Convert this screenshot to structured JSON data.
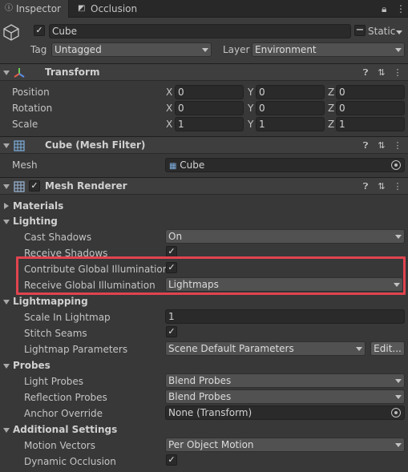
{
  "tabs": {
    "inspector": "Inspector",
    "occlusion": "Occlusion"
  },
  "object": {
    "name": "Cube",
    "active": true,
    "static_label": "Static",
    "tag_label": "Tag",
    "tag_value": "Untagged",
    "layer_label": "Layer",
    "layer_value": "Environment"
  },
  "transform": {
    "title": "Transform",
    "axes": {
      "x": "X",
      "y": "Y",
      "z": "Z"
    },
    "position": {
      "label": "Position",
      "x": "0",
      "y": "0",
      "z": "0"
    },
    "rotation": {
      "label": "Rotation",
      "x": "0",
      "y": "0",
      "z": "0"
    },
    "scale": {
      "label": "Scale",
      "x": "1",
      "y": "1",
      "z": "1"
    }
  },
  "mesh_filter": {
    "title": "Cube (Mesh Filter)",
    "mesh_label": "Mesh",
    "mesh_value": "Cube"
  },
  "mesh_renderer": {
    "title": "Mesh Renderer",
    "enabled": true,
    "materials": "Materials",
    "lighting": "Lighting",
    "cast_shadows_label": "Cast Shadows",
    "cast_shadows_value": "On",
    "receive_shadows_label": "Receive Shadows",
    "contribute_gi_label": "Contribute Global Illumination",
    "receive_gi_label": "Receive Global Illumination",
    "receive_gi_value": "Lightmaps",
    "lightmapping": "Lightmapping",
    "scale_lightmap_label": "Scale In Lightmap",
    "scale_lightmap_value": "1",
    "stitch_seams_label": "Stitch Seams",
    "lightmap_params_label": "Lightmap Parameters",
    "lightmap_params_value": "Scene Default Parameters",
    "edit_button": "Edit...",
    "probes": "Probes",
    "light_probes_label": "Light Probes",
    "light_probes_value": "Blend Probes",
    "reflection_probes_label": "Reflection Probes",
    "reflection_probes_value": "Blend Probes",
    "anchor_override_label": "Anchor Override",
    "anchor_override_value": "None (Transform)",
    "additional": "Additional Settings",
    "motion_vectors_label": "Motion Vectors",
    "motion_vectors_value": "Per Object Motion",
    "dynamic_occlusion_label": "Dynamic Occlusion"
  },
  "colors": {
    "highlight": "#e0444f",
    "background": "#383838"
  }
}
